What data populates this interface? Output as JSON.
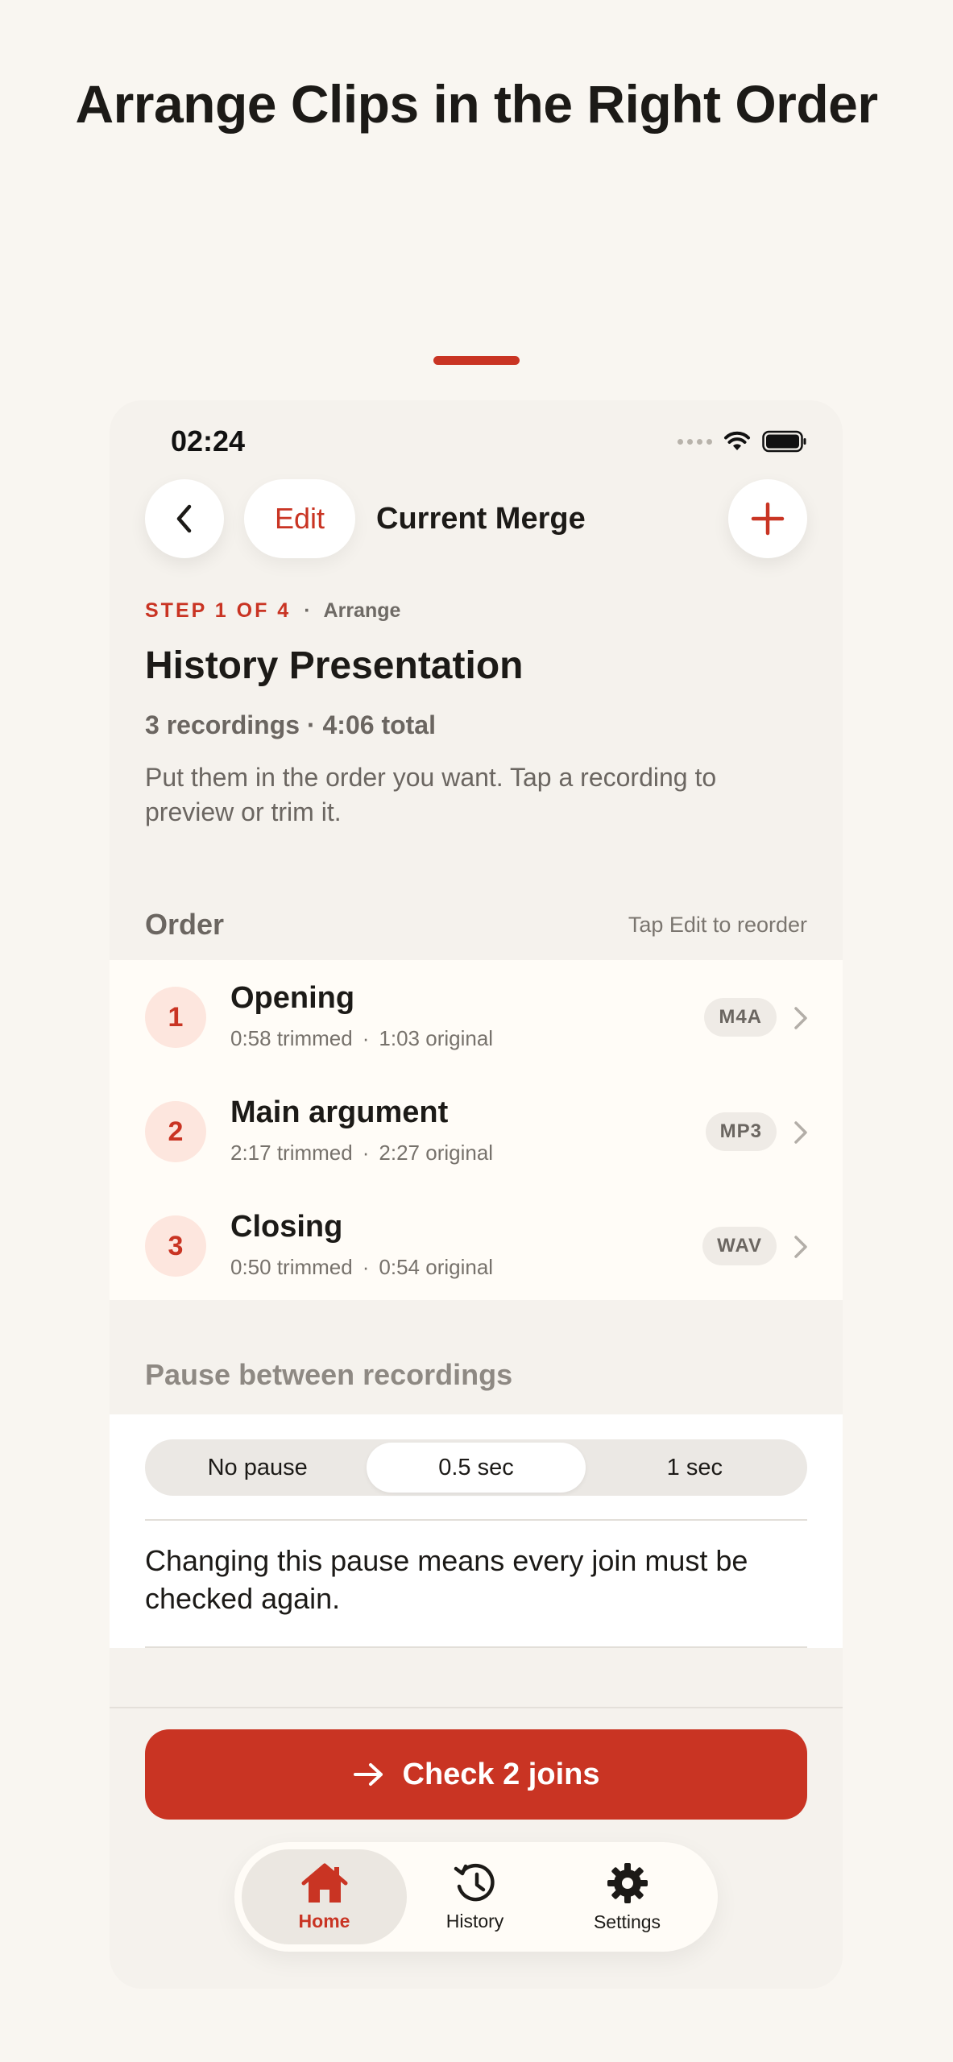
{
  "headline": "Arrange Clips in the Right Order",
  "status": {
    "time": "02:24"
  },
  "nav": {
    "edit_label": "Edit",
    "title": "Current Merge"
  },
  "step": {
    "tag": "STEP 1 OF 4",
    "separator": "·",
    "name": "Arrange"
  },
  "project": {
    "title": "History Presentation",
    "summary": "3 recordings · 4:06 total",
    "description": "Put them in the order you want. Tap a recording to preview or trim it."
  },
  "order_section": {
    "title": "Order",
    "hint": "Tap Edit to reorder"
  },
  "clips": [
    {
      "index": "1",
      "name": "Opening",
      "trimmed": "0:58 trimmed",
      "original": "1:03 original",
      "format": "M4A"
    },
    {
      "index": "2",
      "name": "Main argument",
      "trimmed": "2:17 trimmed",
      "original": "2:27 original",
      "format": "MP3"
    },
    {
      "index": "3",
      "name": "Closing",
      "trimmed": "0:50 trimmed",
      "original": "0:54 original",
      "format": "WAV"
    }
  ],
  "meta_separator": "·",
  "pause": {
    "title": "Pause between recordings",
    "options": [
      "No pause",
      "0.5 sec",
      "1 sec"
    ],
    "selected": "0.5 sec",
    "note": "Changing this pause means every join must be checked again."
  },
  "cta": {
    "label": "Check 2 joins"
  },
  "tabs": [
    {
      "label": "Home",
      "icon": "home-icon",
      "active": true
    },
    {
      "label": "History",
      "icon": "history-icon",
      "active": false
    },
    {
      "label": "Settings",
      "icon": "gear-icon",
      "active": false
    }
  ],
  "colors": {
    "accent": "#c93423",
    "background": "#f9f6f1",
    "badge_bg": "#fde6de"
  }
}
